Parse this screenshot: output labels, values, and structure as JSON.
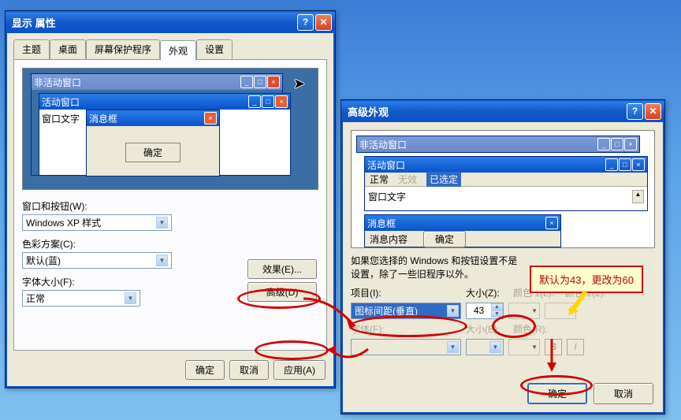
{
  "dlg1": {
    "title": "显示 属性",
    "tabs": [
      "主题",
      "桌面",
      "屏幕保护程序",
      "外观",
      "设置"
    ],
    "activeTabIndex": 3,
    "preview": {
      "inactive_title": "非活动窗口",
      "active_title": "活动窗口",
      "window_text": "窗口文字",
      "msgbox_title": "消息框",
      "msgbox_ok": "确定"
    },
    "labels": {
      "windows_buttons": "窗口和按钮(W):",
      "color_scheme": "色彩方案(C):",
      "font_size": "字体大小(F):"
    },
    "values": {
      "windows_buttons": "Windows XP 样式",
      "color_scheme": "默认(蓝)",
      "font_size": "正常"
    },
    "buttons": {
      "effects": "效果(E)...",
      "advanced": "高级(D)",
      "ok": "确定",
      "cancel": "取消",
      "apply": "应用(A)"
    }
  },
  "dlg2": {
    "title": "高级外观",
    "preview": {
      "inactive_title": "非活动窗口",
      "active_title": "活动窗口",
      "menu_normal": "正常",
      "menu_disabled": "无效",
      "menu_selected": "已选定",
      "window_text": "窗口文字",
      "msgbox_title": "消息框",
      "msgbox_text": "消息内容",
      "msgbox_ok": "确定"
    },
    "hint": "如果您选择的 Windows 和按钮设置不是\n设置，除了一些旧程序以外。",
    "labels": {
      "item": "项目(I):",
      "size": "大小(Z):",
      "color1": "颜色 1(L):",
      "color2": "颜色 2(2):",
      "font": "字体(F):",
      "fsize": "大小(E):",
      "fcolor": "颜色(R):"
    },
    "values": {
      "item": "图标间距(垂直)",
      "size": "43"
    },
    "buttons": {
      "ok": "确定",
      "cancel": "取消",
      "bold": "B",
      "italic": "I"
    }
  },
  "callout_text": "默认为43，更改为60",
  "icons": {
    "help": "?",
    "close": "✕",
    "min": "_",
    "max": "□",
    "dropdown": "▼",
    "spin_up": "▲",
    "spin_down": "▼"
  }
}
